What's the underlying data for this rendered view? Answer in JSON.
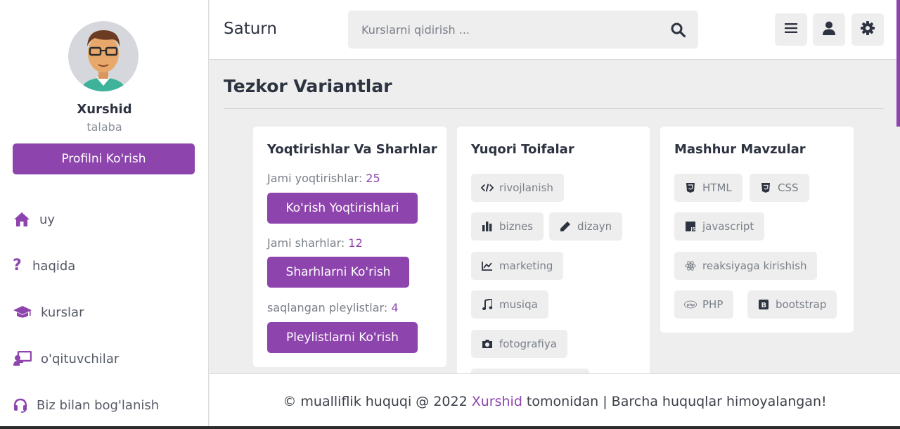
{
  "colors": {
    "accent": "#8e44ad",
    "background": "#eeeeee",
    "text": "#2d3340",
    "muted": "#7a7f88"
  },
  "sidebar": {
    "profile": {
      "name": "Xurshid",
      "role": "talaba",
      "button": "Profilni Ko'rish"
    },
    "nav": [
      {
        "label": "uy",
        "icon": "home-icon"
      },
      {
        "label": "haqida",
        "icon": "question-icon"
      },
      {
        "label": "kurslar",
        "icon": "graduation-cap-icon"
      },
      {
        "label": "o'qituvchilar",
        "icon": "chalkboard-teacher-icon"
      },
      {
        "label": "Biz bilan bog'lanish",
        "icon": "headset-icon"
      }
    ]
  },
  "header": {
    "logo": "Saturn",
    "search_placeholder": "Kurslarni qidirish ...",
    "buttons": [
      "menu-icon",
      "user-icon",
      "gear-icon"
    ]
  },
  "main": {
    "title": "Tezkor Variantlar",
    "likes_card": {
      "title": "Yoqtirishlar Va Sharhlar",
      "likes_label": "Jami yoqtirishlar: ",
      "likes_count": "25",
      "likes_button": "Ko'rish Yoqtirishlari",
      "comments_label": "Jami sharhlar: ",
      "comments_count": "12",
      "comments_button": "Sharhlarni Ko'rish",
      "playlists_label": "saqlangan pleylistlar: ",
      "playlists_count": "4",
      "playlists_button": "Pleylistlarni Ko'rish"
    },
    "categories_card": {
      "title": "Yuqori Toifalar",
      "tags": [
        {
          "label": "rivojlanish",
          "icon": "code-icon"
        },
        {
          "label": "biznes",
          "icon": "bar-chart-icon"
        },
        {
          "label": "dizayn",
          "icon": "pen-icon"
        },
        {
          "label": "marketing",
          "icon": "line-chart-icon"
        },
        {
          "label": "musiqa",
          "icon": "music-icon"
        },
        {
          "label": "fotografiya",
          "icon": "camera-icon"
        }
      ]
    },
    "topics_card": {
      "title": "Mashhur Mavzular",
      "tags": [
        {
          "label": "HTML",
          "icon": "html5-icon"
        },
        {
          "label": "CSS",
          "icon": "css3-icon"
        },
        {
          "label": "javascript",
          "icon": "js-icon"
        },
        {
          "label": "reaksiyaga kirishish",
          "icon": "react-icon"
        },
        {
          "label": "PHP",
          "icon": "php-icon"
        },
        {
          "label": "bootstrap",
          "icon": "bootstrap-icon"
        }
      ]
    }
  },
  "footer": {
    "prefix": "© mualliflik huquqi @ 2022 ",
    "author": "Xurshid",
    "suffix": " tomonidan | Barcha huquqlar himoyalangan!"
  }
}
